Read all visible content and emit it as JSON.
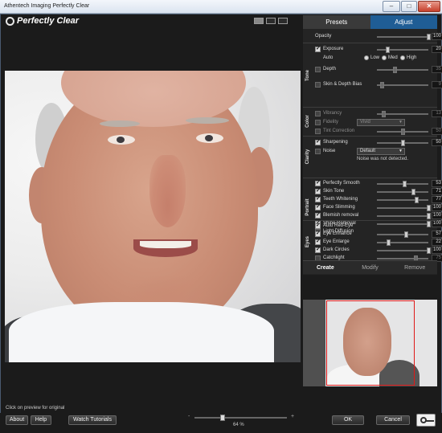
{
  "window": {
    "title": "Athentech Imaging Perfectly Clear"
  },
  "app": {
    "logo_text": "Perfectly Clear"
  },
  "preview": {
    "hint": "Click on preview for original"
  },
  "tabs": [
    {
      "label": "Presets"
    },
    {
      "label": "Adjust"
    }
  ],
  "active_tab": "Adjust",
  "sections": {
    "opacity": {
      "label": "Opacity",
      "value": "100",
      "level": 1.0
    },
    "tone": {
      "title": "Tone",
      "exposure": {
        "label": "Exposure",
        "value": "20",
        "level": 0.2,
        "checked": true
      },
      "auto": {
        "label": "Auto",
        "options": [
          "Low",
          "Med",
          "High"
        ]
      },
      "depth": {
        "label": "Depth",
        "value": "35",
        "level": 0.35,
        "checked": false
      },
      "skin_depth_bias": {
        "label": "Skin & Depth Bias",
        "value": "9",
        "level": 0.09,
        "checked": false
      }
    },
    "color": {
      "title": "Color",
      "vibrancy": {
        "label": "Vibrancy",
        "value": "13",
        "level": 0.13,
        "checked": false
      },
      "fidelity": {
        "label": "Fidelity",
        "selected": "Vivid",
        "checked": false
      },
      "tint_correction": {
        "label": "Tint Correction",
        "value": "50",
        "level": 0.5,
        "checked": false
      }
    },
    "clarity": {
      "title": "Clarity",
      "sharpening": {
        "label": "Sharpening",
        "value": "50",
        "level": 0.5,
        "checked": true
      },
      "noise": {
        "label": "Noise",
        "selected": "Default",
        "checked": false,
        "note": "Noise was not detected."
      }
    },
    "portrait": {
      "title": "Portrait",
      "items": [
        {
          "label": "Perfectly Smooth",
          "value": "53",
          "level": 0.53,
          "checked": true
        },
        {
          "label": "Skin Tone",
          "value": "71",
          "level": 0.71,
          "checked": true
        },
        {
          "label": "Teeth Whitening",
          "value": "77",
          "level": 0.77,
          "checked": true
        },
        {
          "label": "Face Slimming",
          "value": "100",
          "level": 1.0,
          "checked": true
        },
        {
          "label": "Blemish removal",
          "value": "100",
          "level": 1.0,
          "checked": true
        },
        {
          "label": "Shine Removal",
          "value": "100",
          "level": 1.0,
          "checked": true
        },
        {
          "label": "Light Diffusion",
          "checked": false
        }
      ]
    },
    "eyes": {
      "title": "Eyes",
      "items": [
        {
          "label": "Auto Red-Eye",
          "checked": true
        },
        {
          "label": "Eye Enhance",
          "value": "57",
          "level": 0.57,
          "checked": true
        },
        {
          "label": "Eye Enlarge",
          "value": "22",
          "level": 0.22,
          "checked": true
        },
        {
          "label": "Dark Circles",
          "value": "100",
          "level": 1.0,
          "checked": true
        },
        {
          "label": "Catchlight",
          "value": "75",
          "level": 0.75,
          "checked": false
        }
      ]
    }
  },
  "actions": [
    {
      "label": "Create"
    },
    {
      "label": "Modify"
    },
    {
      "label": "Remove"
    }
  ],
  "bottom": {
    "about": "About",
    "help": "Help",
    "tutorials": "Watch Tutorials",
    "zoom": {
      "value": "64 %",
      "level": 0.3
    },
    "ok": "OK",
    "cancel": "Cancel"
  }
}
